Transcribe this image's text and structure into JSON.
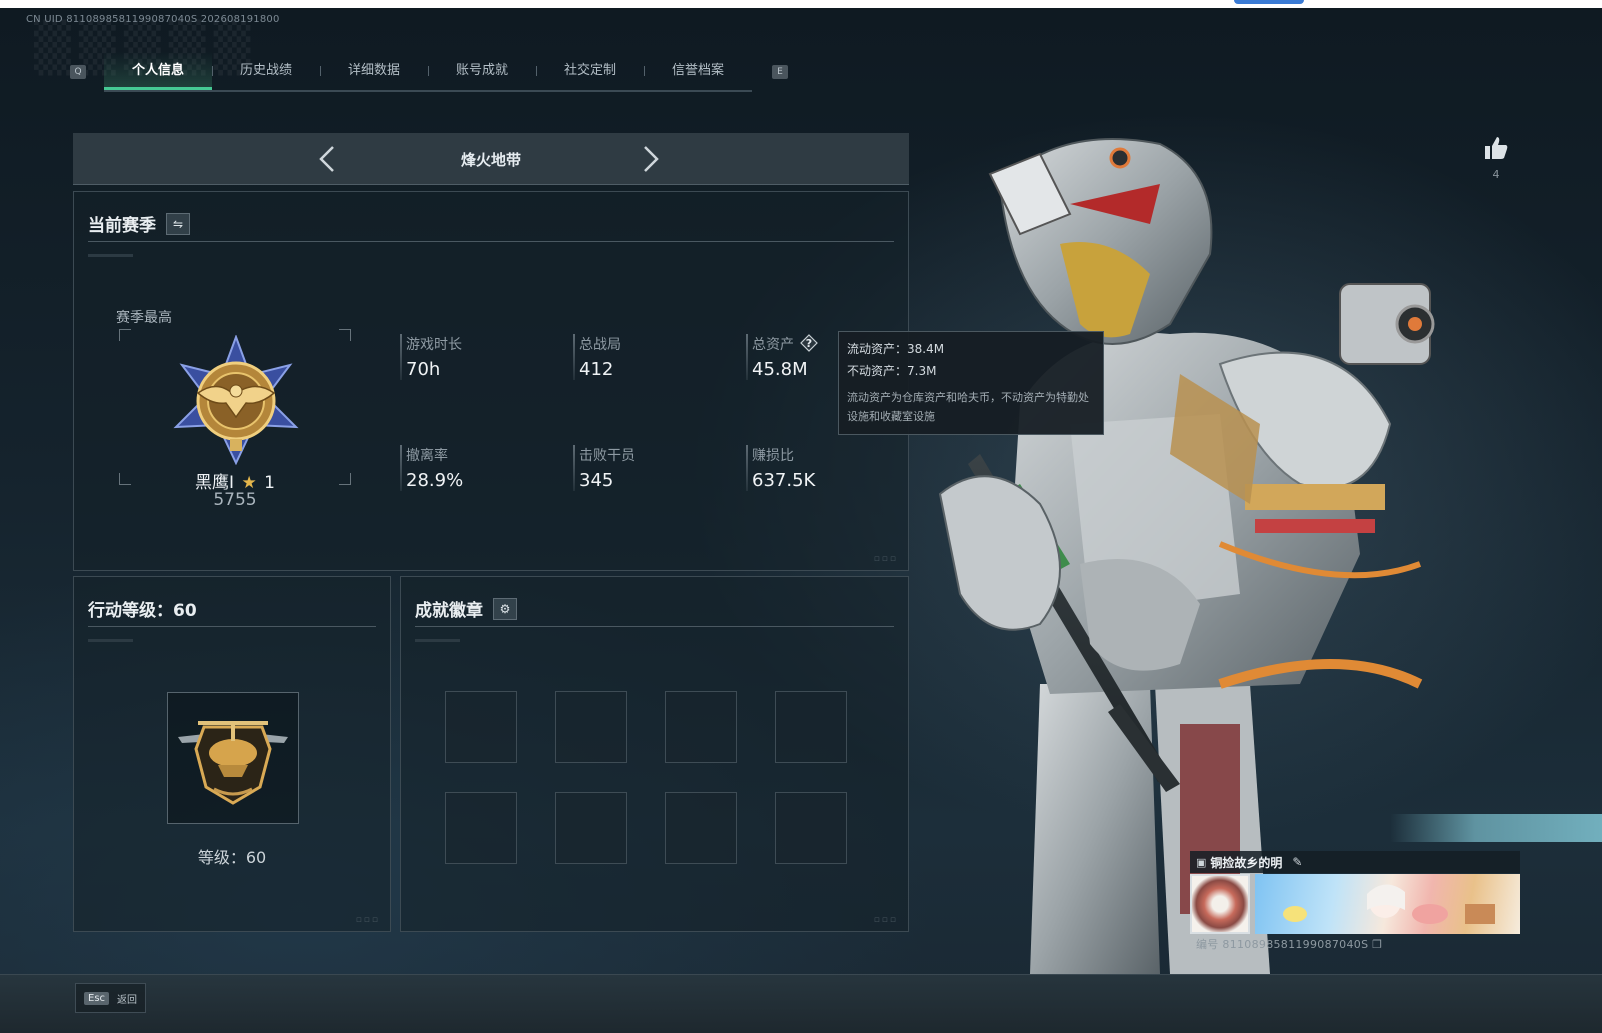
{
  "header": {
    "uid_line": "CN UID 8110898581199087040S 202608191800"
  },
  "tabs": {
    "left_key": "Q",
    "right_key": "E",
    "items": [
      {
        "label": "个人信息",
        "active": true
      },
      {
        "label": "历史战绩",
        "active": false
      },
      {
        "label": "详细数据",
        "active": false
      },
      {
        "label": "账号成就",
        "active": false
      },
      {
        "label": "社交定制",
        "active": false
      },
      {
        "label": "信誉档案",
        "active": false
      }
    ]
  },
  "mode": {
    "title": "烽火地带"
  },
  "season": {
    "title": "当前赛季",
    "best_label": "赛季最高",
    "rank_name": "黑鹰I",
    "rank_star": "★",
    "rank_stars": "1",
    "rank_score": "5755",
    "stats": [
      {
        "label": "游戏时长",
        "value": "70h"
      },
      {
        "label": "总战局",
        "value": "412"
      },
      {
        "label": "总资产",
        "value": "45.8M",
        "help": true
      },
      {
        "label": "撤离率",
        "value": "28.9%"
      },
      {
        "label": "击败干员",
        "value": "345"
      },
      {
        "label": "赚损比",
        "value": "637.5K"
      }
    ]
  },
  "tooltip": {
    "liquid": "流动资产：38.4M",
    "fixed": "不动资产：7.3M",
    "description": "流动资产为仓库资产和哈夫币，不动资产为特勤处设施和收藏室设施"
  },
  "level": {
    "title": "行动等级：60",
    "level_label": "等级：60"
  },
  "achievements": {
    "title": "成就徽章",
    "slots": 8
  },
  "like": {
    "count": "4"
  },
  "name_card": {
    "title": "铜捡故乡的明",
    "uid": "编号 8110898581199087040S"
  },
  "footer": {
    "esc_key": "Esc",
    "esc_label": "返回"
  },
  "colors": {
    "accent_green": "#46c994",
    "gold": "#e4b64c"
  }
}
